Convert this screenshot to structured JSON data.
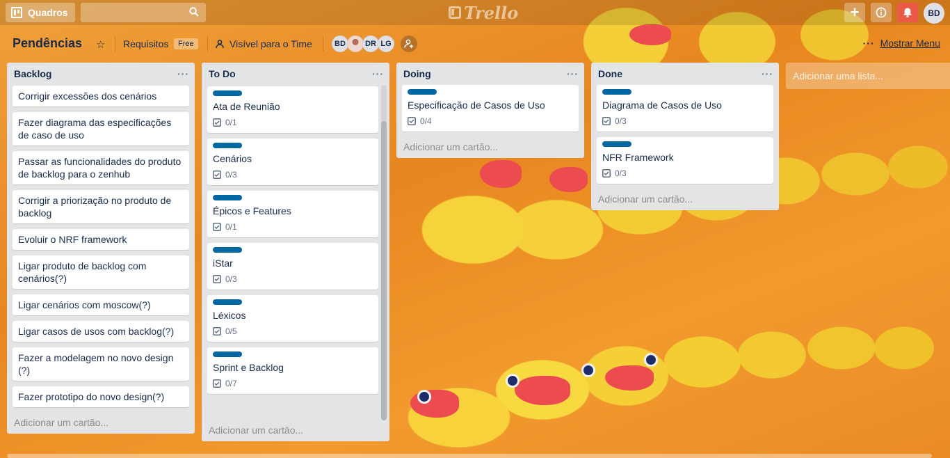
{
  "header": {
    "boards_label": "Quadros",
    "search_value": "",
    "logo_text": "Trello",
    "user_initials": "BD"
  },
  "board": {
    "title": "Pendências",
    "team": "Requisitos",
    "team_badge": "Free",
    "visibility": "Visível para o Time",
    "members": [
      "BD",
      "",
      "DR",
      "LG"
    ],
    "menu_label": "Mostrar Menu"
  },
  "lists": {
    "backlog": {
      "title": "Backlog",
      "cards": [
        "Corrigir excessões dos cenários",
        "Fazer diagrama das especificações de caso de uso",
        "Passar as funcionalidades do produto de backlog para o zenhub",
        "Corrigir a priorização no produto de backlog",
        "Evoluir o NRF framework",
        "Ligar produto de backlog com cenários(?)",
        "Ligar cenários com moscow(?)",
        "Ligar casos de usos com backlog(?)",
        "Fazer a modelagem no novo design (?)",
        "Fazer prototipo do novo design(?)"
      ],
      "add_card": "Adicionar um cartão..."
    },
    "todo": {
      "title": "To Do",
      "cards": [
        {
          "title": "Ata de Reunião",
          "checklist": "0/1"
        },
        {
          "title": "Cenários",
          "checklist": "0/3"
        },
        {
          "title": "Épicos e Features",
          "checklist": "0/1"
        },
        {
          "title": "iStar",
          "checklist": "0/3"
        },
        {
          "title": "Léxicos",
          "checklist": "0/5"
        },
        {
          "title": "Sprint e Backlog",
          "checklist": "0/7"
        }
      ],
      "add_card": "Adicionar um cartão..."
    },
    "doing": {
      "title": "Doing",
      "cards": [
        {
          "title": "Especificação de Casos de Uso",
          "checklist": "0/4"
        }
      ],
      "add_card": "Adicionar um cartão..."
    },
    "done": {
      "title": "Done",
      "cards": [
        {
          "title": "Diagrama de Casos de Uso",
          "checklist": "0/3"
        },
        {
          "title": "NFR Framework",
          "checklist": "0/3"
        }
      ],
      "add_card": "Adicionar um cartão..."
    },
    "add_list": "Adicionar uma lista..."
  },
  "colors": {
    "label_blue": "#0067a3",
    "notification_red": "#eb5a46",
    "list_bg": "#e2e4e6"
  }
}
